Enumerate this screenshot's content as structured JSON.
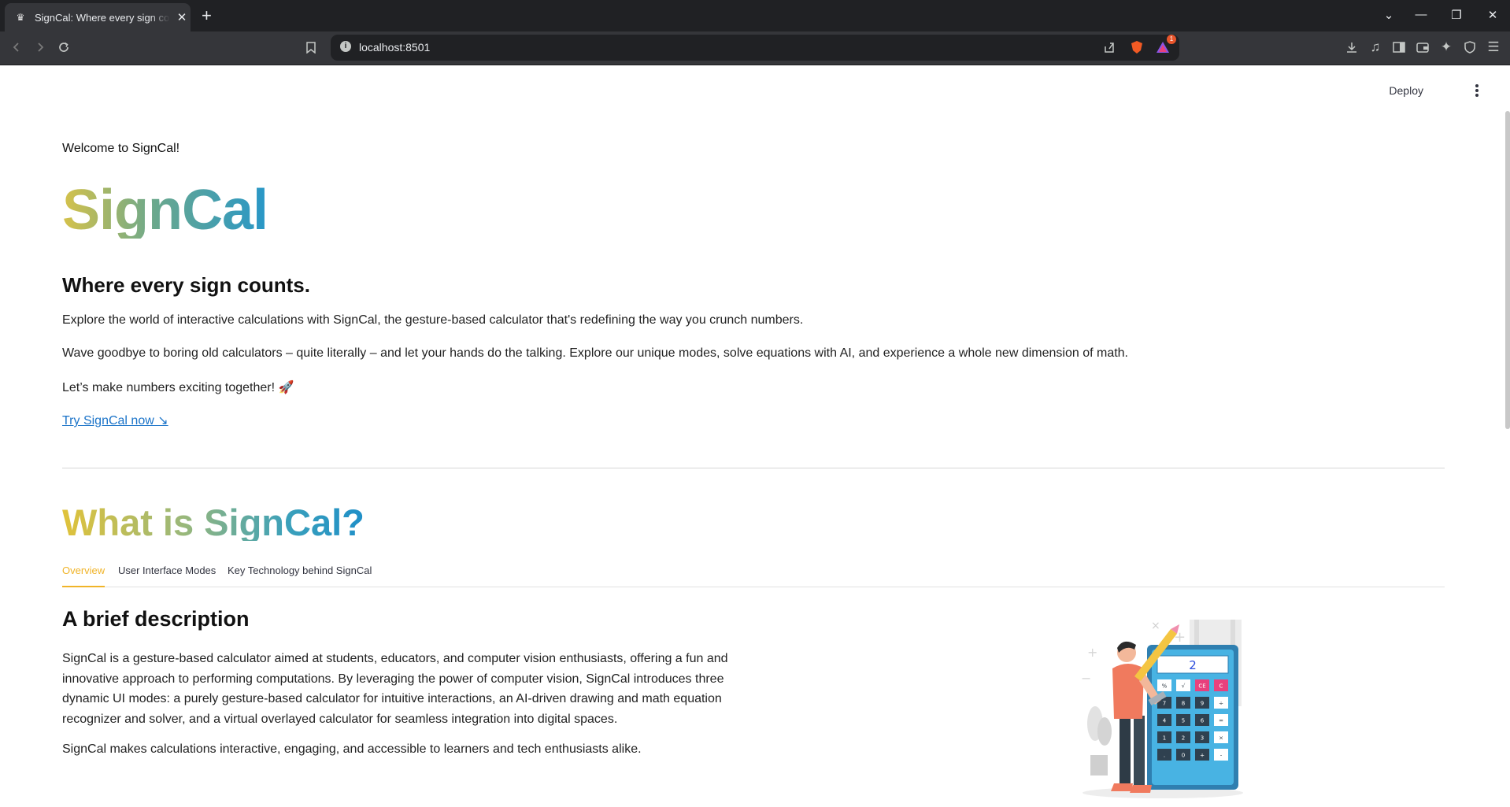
{
  "browser": {
    "tab_title": "SignCal: Where every sign counts",
    "new_tab_symbol": "+",
    "close_symbol": "✕",
    "url": "localhost:8501",
    "shield_badge": "1"
  },
  "app_header": {
    "deploy_label": "Deploy"
  },
  "hero": {
    "welcome": "Welcome to SignCal!",
    "brand": "SignCal",
    "tagline": "Where every sign counts.",
    "para1": "Explore the world of interactive calculations with SignCal, the gesture-based calculator that's redefining the way you crunch numbers.",
    "para2": "Wave goodbye to boring old calculators – quite literally – and let your hands do the talking. Explore our unique modes, solve equations with AI, and experience a whole new dimension of math.",
    "para3": "Let’s make numbers exciting together! 🚀",
    "cta": "Try SignCal now ↘"
  },
  "about": {
    "title": "What is SignCal?",
    "tabs": [
      "Overview",
      "User Interface Modes",
      "Key Technology behind SignCal"
    ],
    "active_tab": 0,
    "subheading": "A brief description",
    "description": "SignCal is a gesture-based calculator aimed at students, educators, and computer vision enthusiasts, offering a fun and innovative approach to performing computations. By leveraging the power of computer vision, SignCal introduces three dynamic UI modes: a purely gesture-based calculator for intuitive interactions, an AI-driven drawing and math equation recognizer and solver, and a virtual overlayed calculator for seamless integration into digital spaces.",
    "description2": "SignCal makes calculations interactive, engaging, and accessible to learners and tech enthusiasts alike."
  },
  "illustration": {
    "display_value": "2",
    "keys": [
      "%",
      "√",
      "CE",
      "C",
      "7",
      "8",
      "9",
      "÷",
      "4",
      "5",
      "6",
      "=",
      "1",
      "2",
      "3",
      "×",
      ".",
      "0",
      "+",
      "-"
    ]
  },
  "colors": {
    "accent_tab": "#f0b429",
    "link": "#1a73c8",
    "brand_gradient_start": "#d6c24a",
    "brand_gradient_end": "#2897c8"
  }
}
